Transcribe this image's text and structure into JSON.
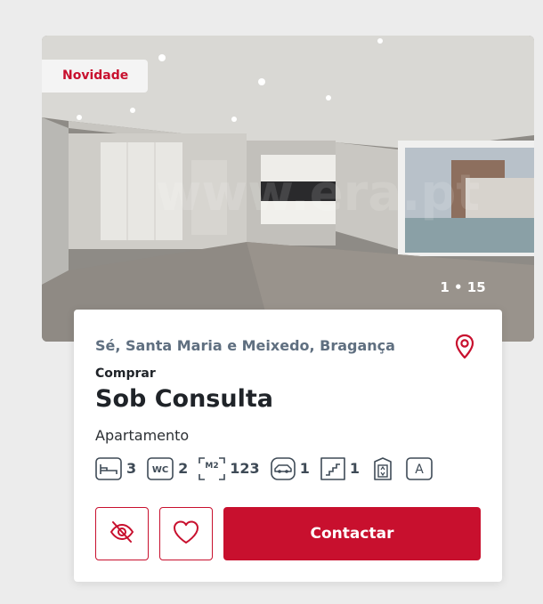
{
  "listing": {
    "badge": "Novidade",
    "photo_counter": "1 • 15",
    "watermark": "www.era.pt",
    "location": "Sé, Santa Maria e Meixedo, Bragança",
    "operation": "Comprar",
    "price": "Sob Consulta",
    "property_type": "Apartamento"
  },
  "features": {
    "bedrooms": "3",
    "bathrooms": "2",
    "area": "123",
    "parking": "1",
    "floor": "1",
    "area_icon_label": "M2",
    "bath_icon_label": "WC",
    "energy_icon_label": "A"
  },
  "actions": {
    "contact_label": "Contactar"
  },
  "colors": {
    "brand": "#c8102e",
    "icon": "#3e4a56",
    "location_text": "#5f6f80",
    "background": "#ececec"
  },
  "icons": [
    "map-pin-icon",
    "bed-icon",
    "wc-icon",
    "area-icon",
    "car-icon",
    "stairs-icon",
    "elevator-icon",
    "energy-icon",
    "eye-off-icon",
    "heart-icon"
  ]
}
